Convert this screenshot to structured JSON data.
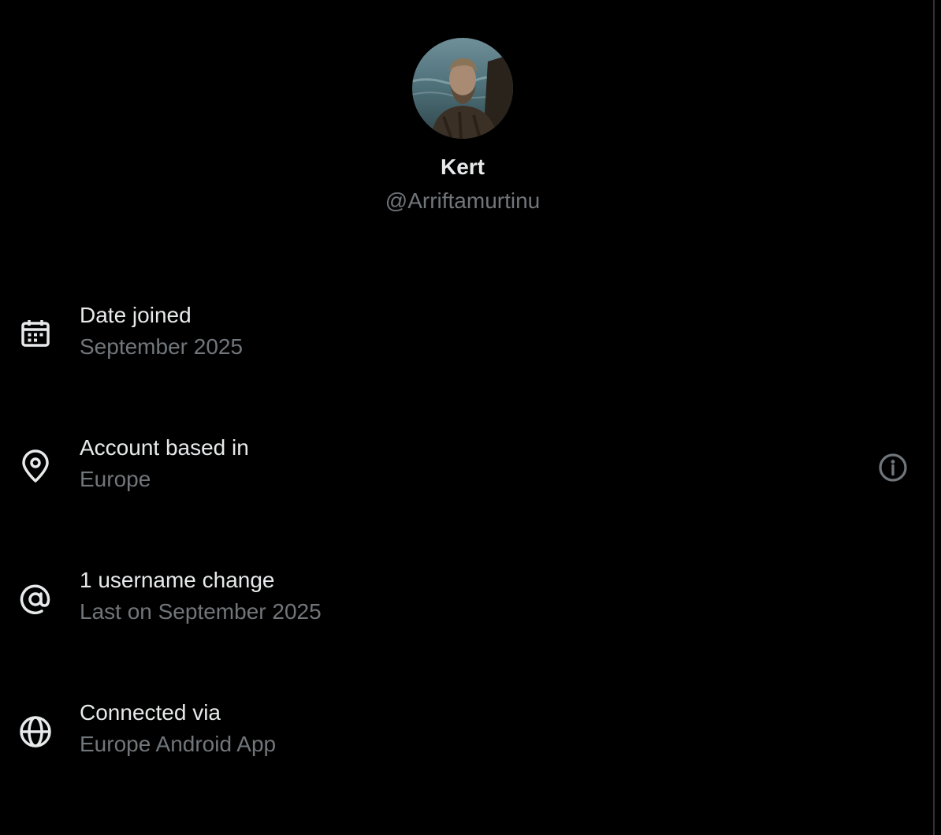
{
  "profile": {
    "display_name": "Kert",
    "handle": "@Arriftamurtinu",
    "avatar_description": "profile-photo"
  },
  "details": [
    {
      "icon": "calendar-icon",
      "title": "Date joined",
      "value": "September 2025"
    },
    {
      "icon": "location-pin-icon",
      "title": "Account based in",
      "value": "Europe",
      "has_info_button": true
    },
    {
      "icon": "at-sign-icon",
      "title": "1 username change",
      "value": "Last on September 2025"
    },
    {
      "icon": "globe-icon",
      "title": "Connected via",
      "value": "Europe Android App"
    }
  ],
  "colors": {
    "background": "#000000",
    "primary_text": "#e7e9ea",
    "secondary_text": "#71767b",
    "divider": "#2f3336"
  }
}
